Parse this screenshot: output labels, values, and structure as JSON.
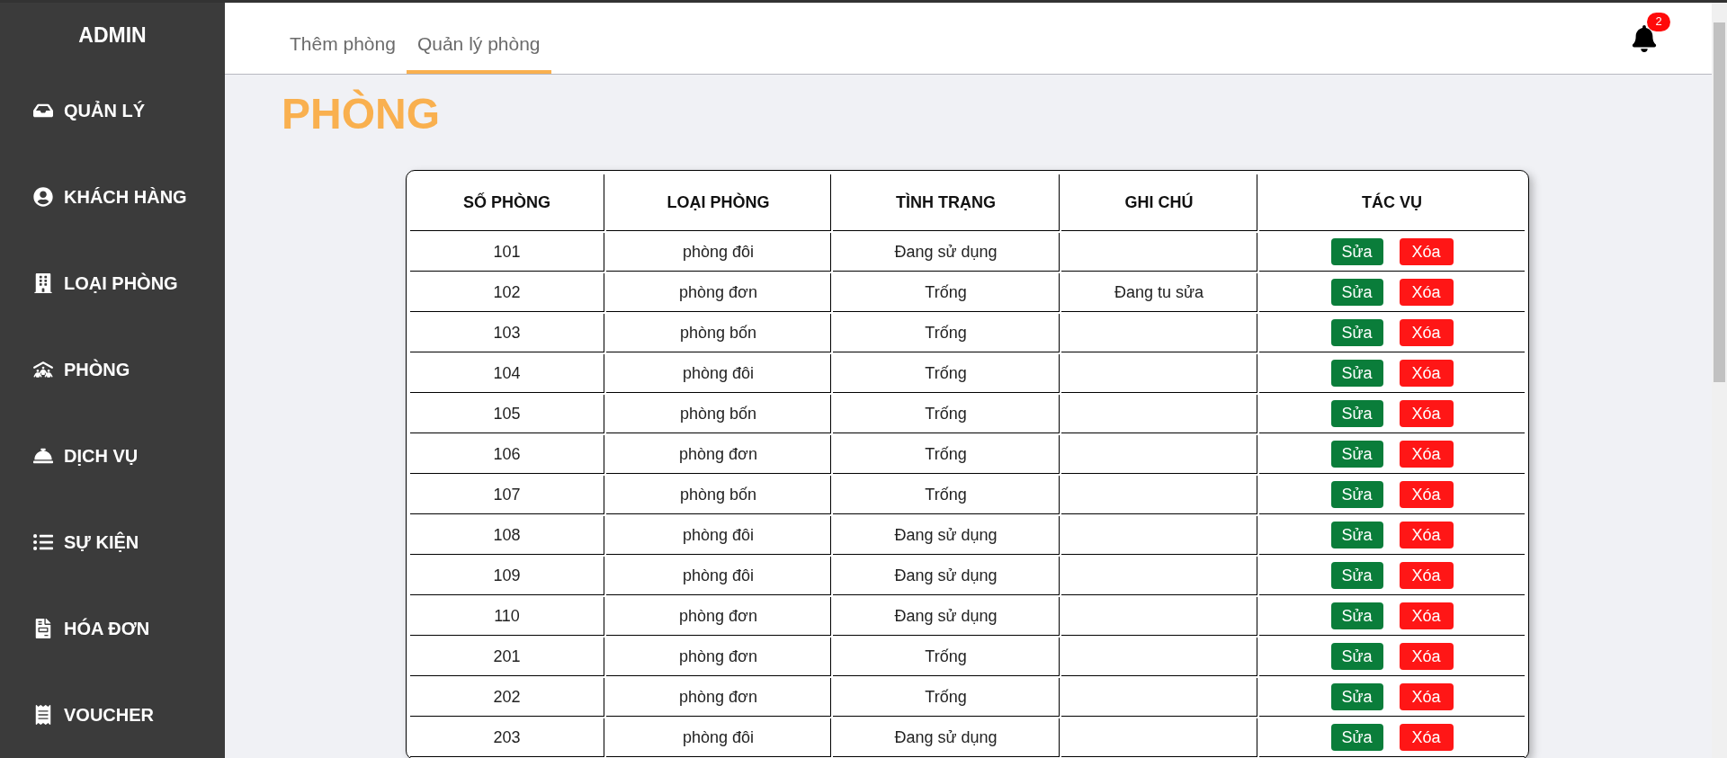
{
  "sidebar": {
    "title": "ADMIN",
    "items": [
      {
        "label": "QUẢN LÝ",
        "kind": "inbox"
      },
      {
        "label": "KHÁCH HÀNG",
        "kind": "user"
      },
      {
        "label": "LOẠI PHÒNG",
        "kind": "building"
      },
      {
        "label": "PHÒNG",
        "kind": "people-roof"
      },
      {
        "label": "DỊCH VỤ",
        "kind": "bell"
      },
      {
        "label": "SỰ KIỆN",
        "kind": "list"
      },
      {
        "label": "HÓA ĐƠN",
        "kind": "file"
      },
      {
        "label": "VOUCHER",
        "kind": "receipt"
      }
    ]
  },
  "tabs": [
    {
      "label": "Thêm phòng",
      "selected": false
    },
    {
      "label": "Quản lý phòng",
      "selected": true
    }
  ],
  "notifications": {
    "count": "2"
  },
  "page_title": "PHÒNG",
  "table": {
    "columns": [
      "SỐ PHÒNG",
      "LOẠI PHÒNG",
      "TÌNH TRẠNG",
      "GHI CHÚ",
      "TÁC VỤ"
    ],
    "rows": [
      {
        "number": "101",
        "type": "phòng đôi",
        "status": "Đang sử dụng",
        "note": "",
        "edit": "Sửa",
        "delete": "Xóa"
      },
      {
        "number": "102",
        "type": "phòng đơn",
        "status": "Trống",
        "note": "Đang tu sửa",
        "edit": "Sửa",
        "delete": "Xóa"
      },
      {
        "number": "103",
        "type": "phòng bốn",
        "status": "Trống",
        "note": "",
        "edit": "Sửa",
        "delete": "Xóa"
      },
      {
        "number": "104",
        "type": "phòng đôi",
        "status": "Trống",
        "note": "",
        "edit": "Sửa",
        "delete": "Xóa"
      },
      {
        "number": "105",
        "type": "phòng bốn",
        "status": "Trống",
        "note": "",
        "edit": "Sửa",
        "delete": "Xóa"
      },
      {
        "number": "106",
        "type": "phòng đơn",
        "status": "Trống",
        "note": "",
        "edit": "Sửa",
        "delete": "Xóa"
      },
      {
        "number": "107",
        "type": "phòng bốn",
        "status": "Trống",
        "note": "",
        "edit": "Sửa",
        "delete": "Xóa"
      },
      {
        "number": "108",
        "type": "phòng đôi",
        "status": "Đang sử dụng",
        "note": "",
        "edit": "Sửa",
        "delete": "Xóa"
      },
      {
        "number": "109",
        "type": "phòng đôi",
        "status": "Đang sử dụng",
        "note": "",
        "edit": "Sửa",
        "delete": "Xóa"
      },
      {
        "number": "110",
        "type": "phòng đơn",
        "status": "Đang sử dụng",
        "note": "",
        "edit": "Sửa",
        "delete": "Xóa"
      },
      {
        "number": "201",
        "type": "phòng đơn",
        "status": "Trống",
        "note": "",
        "edit": "Sửa",
        "delete": "Xóa"
      },
      {
        "number": "202",
        "type": "phòng đơn",
        "status": "Trống",
        "note": "",
        "edit": "Sửa",
        "delete": "Xóa"
      },
      {
        "number": "203",
        "type": "phòng đôi",
        "status": "Đang sử dụng",
        "note": "",
        "edit": "Sửa",
        "delete": "Xóa"
      }
    ]
  }
}
